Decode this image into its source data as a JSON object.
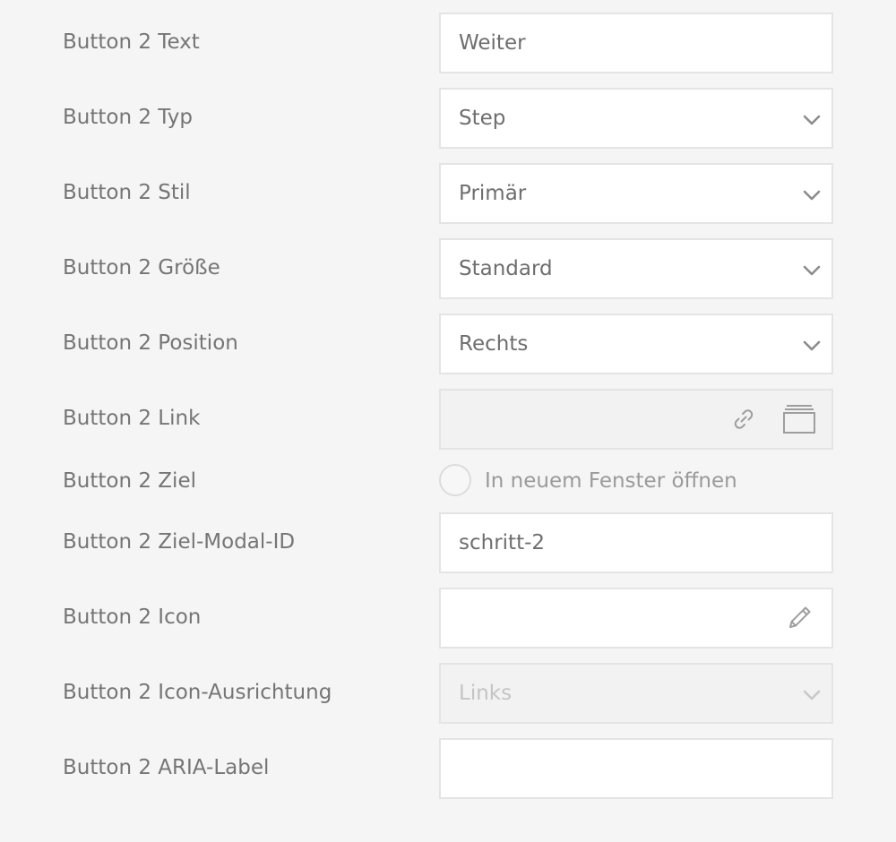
{
  "fields": {
    "text": {
      "label": "Button 2 Text",
      "value": "Weiter"
    },
    "type": {
      "label": "Button 2 Typ",
      "value": "Step"
    },
    "style": {
      "label": "Button 2 Stil",
      "value": "Primär"
    },
    "size": {
      "label": "Button 2 Größe",
      "value": "Standard"
    },
    "position": {
      "label": "Button 2 Position",
      "value": "Rechts"
    },
    "link": {
      "label": "Button 2 Link",
      "value": ""
    },
    "target": {
      "label": "Button 2 Ziel",
      "option_label": "In neuem Fenster öffnen"
    },
    "modal_id": {
      "label": "Button 2 Ziel-Modal-ID",
      "value": "schritt-2"
    },
    "icon": {
      "label": "Button 2 Icon",
      "value": ""
    },
    "icon_alignment": {
      "label": "Button 2 Icon-Ausrichtung",
      "value": "Links"
    },
    "aria_label": {
      "label": "Button 2 ARIA-Label",
      "value": ""
    }
  },
  "icons": {
    "select": "chevron-down-icon",
    "link": "link-icon",
    "browse": "window-icon",
    "edit": "pencil-icon"
  },
  "colors": {
    "background": "#f5f5f5",
    "label_text": "#757575",
    "field_border": "#e4e4e4",
    "disabled_field": "#f2f2f2"
  }
}
